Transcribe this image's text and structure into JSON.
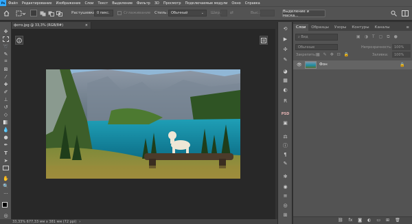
{
  "app": {
    "logo": "Ps"
  },
  "menu": [
    "Файл",
    "Редактирование",
    "Изображение",
    "Слои",
    "Текст",
    "Выделение",
    "Фильтр",
    "3D",
    "Просмотр",
    "Подключаемые модули",
    "Окно",
    "Справка"
  ],
  "options": {
    "feather_label": "Растушевка:",
    "feather_value": "0 пикс.",
    "antialias_label": "Сглаживание",
    "style_label": "Стиль:",
    "style_value": "Обычный",
    "width_label": "Шир.:",
    "height_label": "Выс.:",
    "select_mask_button": "Выделение и маска..."
  },
  "document": {
    "tab_title": "фото.jpg @ 33,3% (RGB/8#)",
    "close": "×"
  },
  "status": {
    "text": "33,33%   677,33 мм x 381 мм (72 ppi)",
    "arrow": "›"
  },
  "panel": {
    "tabs": [
      "Слои",
      "Образцы",
      "Узоры",
      "Контуры",
      "Каналы"
    ],
    "search_placeholder": "Вид",
    "blend_mode": "Обычные",
    "opacity_label": "Непрозрачность:",
    "opacity_value": "100%",
    "lock_label": "Закрепить:",
    "fill_label": "Заливка:",
    "fill_value": "100%",
    "layer_name": "Фон"
  },
  "colors": {
    "accent": "#31a8ff",
    "panel": "#535353",
    "workspace": "#282828"
  }
}
